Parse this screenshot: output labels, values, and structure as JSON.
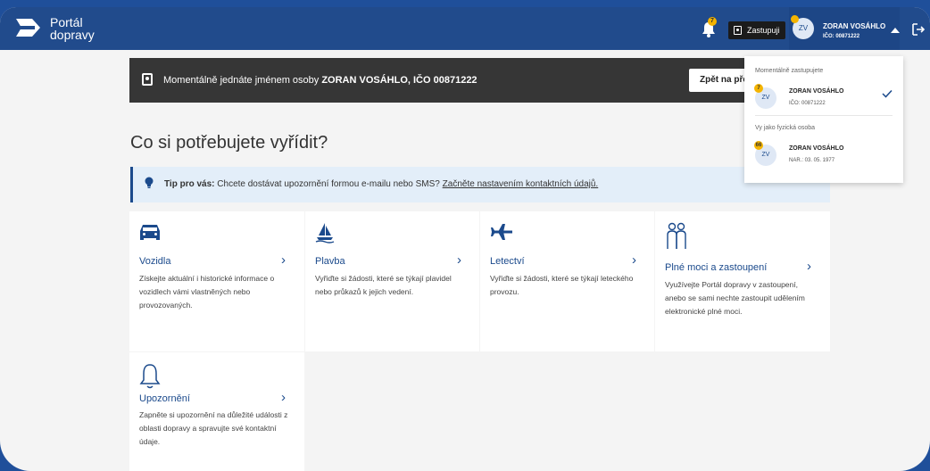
{
  "app": {
    "logo_line1": "Portál",
    "logo_line2": "dopravy"
  },
  "header": {
    "notification_count": "7",
    "zastupuji_label": "Zastupuji",
    "user_initials": "ZV",
    "user_name": "ZORAN VOSÁHLO",
    "user_ico": "IČO: 00871222"
  },
  "representation_bar": {
    "prefix": "Momentálně jednáte jménem osoby",
    "name": "ZORAN VOSÁHLO, IČO 00871222",
    "back_button": "Zpět na přehled"
  },
  "main": {
    "title": "Co si potřebujete vyřídit?",
    "tip_label": "Tip pro vás:",
    "tip_text": "Chcete dostávat upozornění formou e-mailu nebo SMS?",
    "tip_link": "Začněte nastavením kontaktních údajů."
  },
  "cards": [
    {
      "title": "Vozidla",
      "description": "Získejte aktuální i historické informace o vozidlech vámi vlastněných nebo provozovaných.",
      "icon": "car-icon"
    },
    {
      "title": "Plavba",
      "description": "Vyřiďte si žádosti, které se týkají plavidel nebo průkazů k jejich vedení.",
      "icon": "sailboat-icon"
    },
    {
      "title": "Letectví",
      "description": "Vyřiďte si žádosti, které se týkají leteckého provozu.",
      "icon": "airplane-icon"
    },
    {
      "title": "Plné moci a zastoupení",
      "description": "Využívejte Portál dopravy v zastoupení, anebo se sami nechte zastoupit udělením elektronické plné moci.",
      "icon": "people-icon"
    },
    {
      "title": "Upozornění",
      "description": "Zapněte si upozornění na důležité události z oblasti dopravy a spravujte své kontaktní údaje.",
      "icon": "bell-icon"
    }
  ],
  "dropdown": {
    "section1": "Momentálně zastupujete",
    "entity1_initials": "ZV",
    "entity1_badge": "7",
    "entity1_name": "ZORAN VOSÁHLO",
    "entity1_sub": "IČO: 00871222",
    "section2": "Vy jako fyzická osoba",
    "entity2_initials": "ZV",
    "entity2_badge": "66",
    "entity2_name": "ZORAN VOSÁHLO",
    "entity2_sub": "NAR.: 03. 05. 1977"
  },
  "colors": {
    "brand": "#214b8c",
    "accent": "#f4b400",
    "tip_bg": "#e3eef9"
  }
}
